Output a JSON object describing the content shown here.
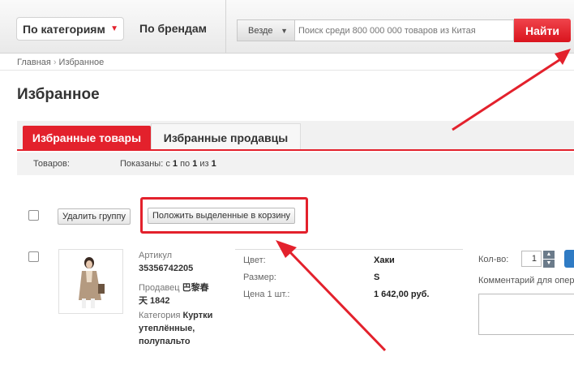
{
  "header": {
    "categories_label": "По категориям",
    "brands_label": "По брендам",
    "scope_value": "Везде",
    "search_placeholder": "Поиск среди 800 000 000 товаров из Китая",
    "search_button": "Найти",
    "accent_color": "#e3212c"
  },
  "breadcrumb": [
    "Главная",
    "Избранное"
  ],
  "page_title": "Избранное",
  "tabs": [
    {
      "label": "Избранные товары",
      "active": true
    },
    {
      "label": "Избранные продавцы",
      "active": false
    }
  ],
  "stats": {
    "goods_label": "Товаров:",
    "shown_prefix": "Показаны: с",
    "from": "1",
    "to_word": "по",
    "to": "1",
    "of_word": "из",
    "total": "1"
  },
  "actions": {
    "delete_group": "Удалить группу",
    "add_to_cart": "Положить выделенные в корзину"
  },
  "product": {
    "sku_label": "Артикул",
    "sku": "35356742205",
    "seller_label": "Продавец",
    "seller_line1": "巴黎春",
    "seller_line2": "天 1842",
    "category_label": "Категория",
    "category_line1": "Куртки",
    "category_line2": "утеплённые,",
    "category_line3": "полупальто",
    "color_label": "Цвет:",
    "color_value": "Хаки",
    "size_label": "Размер:",
    "size_value": "S",
    "price_label": "Цена 1 шт.:",
    "price_value": "1 642,00 руб.",
    "qty_label": "Кол-во:",
    "qty_value": "1",
    "comment_label": "Комментарий для оператора"
  }
}
